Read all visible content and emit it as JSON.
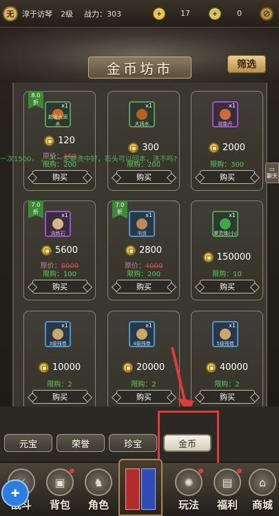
{
  "topbar": {
    "avatar_text": "无",
    "name": "淳于访琴",
    "level": "2级",
    "power": "战力：303",
    "res1_value": "17",
    "res2_value": "0"
  },
  "header": {
    "title": "金币坊市",
    "filter_label": "筛选"
  },
  "chat_scroll_text": "一次1500，    ，    不一定能洗中好，石头可以回本，洗不吗?",
  "chat_button": "聊天",
  "items": [
    {
      "discount": "8.0\n折",
      "name": "超级大润水",
      "qty": "x1",
      "price": "120",
      "orig_label": "原价：",
      "orig": "150",
      "limit_label": "限购：",
      "limit": "200",
      "buy": "购买"
    },
    {
      "discount": "",
      "name": "大润水",
      "qty": "x1",
      "price": "300",
      "orig_label": "",
      "orig": "",
      "limit_label": "限购：",
      "limit": "200",
      "buy": "购买"
    },
    {
      "discount": "",
      "name": "技能丹",
      "qty": "x1",
      "price": "2000",
      "orig_label": "",
      "orig": "",
      "limit_label": "限购：",
      "limit": "300",
      "buy": "购买"
    },
    {
      "discount": "7.0\n折",
      "name": "洗练石",
      "qty": "x1",
      "price": "5600",
      "orig_label": "原价：",
      "orig": "8000",
      "limit_label": "限购：",
      "limit": "100",
      "buy": "购买"
    },
    {
      "discount": "7.0\n折",
      "name": "书页",
      "qty": "x1",
      "price": "2800",
      "orig_label": "原价：",
      "orig": "4000",
      "limit_label": "限购：",
      "limit": "200",
      "buy": "购买"
    },
    {
      "discount": "",
      "name": "聚灵珠(小)",
      "qty": "x1",
      "price": "150000",
      "orig_label": "",
      "orig": "",
      "limit_label": "限购：",
      "limit": "10",
      "buy": "购买"
    },
    {
      "discount": "",
      "name": "3级残卷",
      "qty": "x1",
      "price": "10000",
      "orig_label": "",
      "orig": "",
      "limit_label": "限购：",
      "limit": "2",
      "buy": "购买"
    },
    {
      "discount": "",
      "name": "4级残卷",
      "qty": "x1",
      "price": "20000",
      "orig_label": "",
      "orig": "",
      "limit_label": "限购：",
      "limit": "2",
      "buy": "购买"
    },
    {
      "discount": "",
      "name": "5级残卷",
      "qty": "x1",
      "price": "40000",
      "orig_label": "",
      "orig": "",
      "limit_label": "限购：",
      "limit": "2",
      "buy": "购买"
    }
  ],
  "tabs": [
    "元宝",
    "荣誉",
    "珍宝",
    "金币"
  ],
  "nav": [
    "战斗",
    "背包",
    "角色",
    "玩法",
    "福利",
    "商城"
  ],
  "colors": {
    "accent": "#e0c257",
    "limit_green": "#5ccc5c",
    "highlight_red": "#e03a3a"
  }
}
